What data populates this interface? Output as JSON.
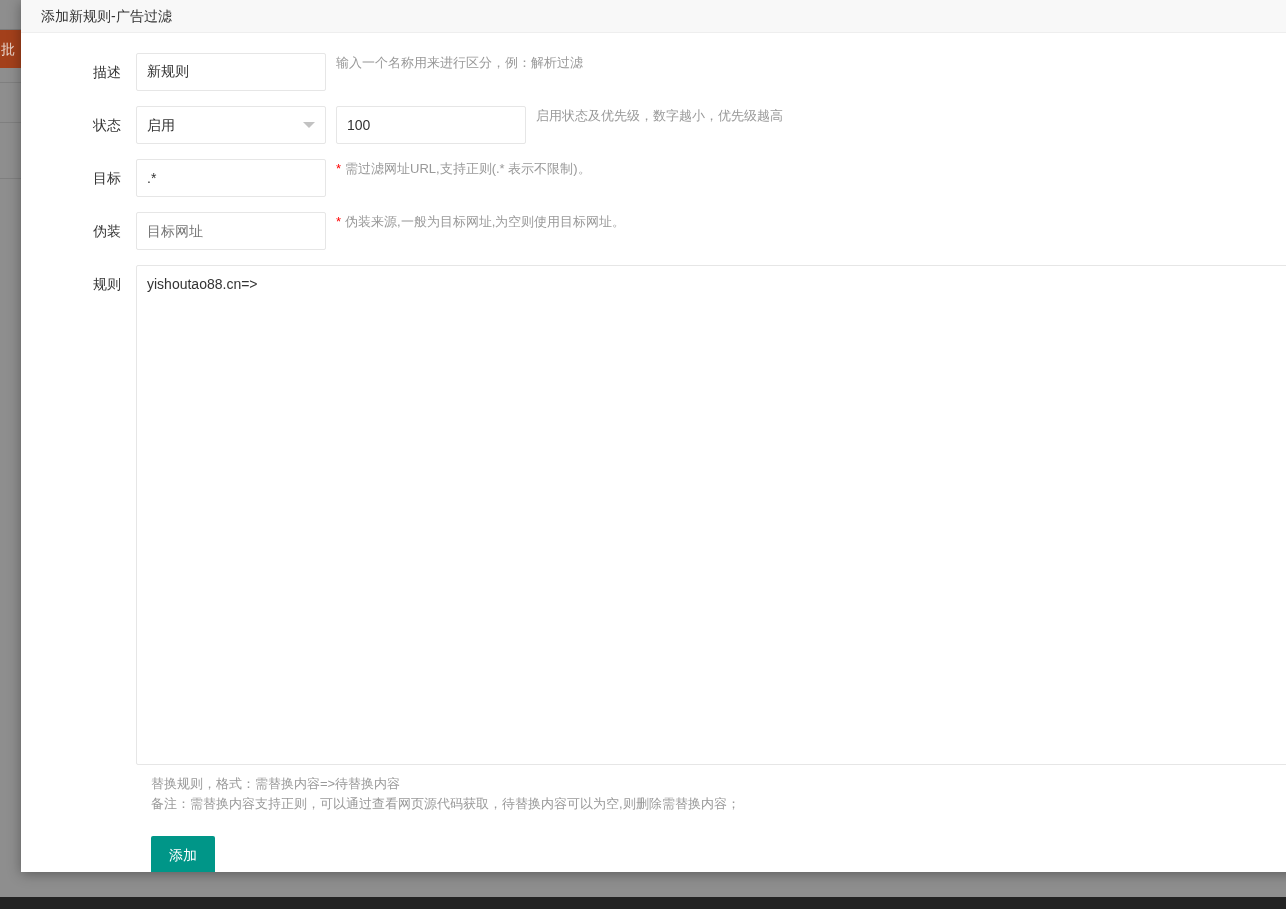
{
  "background": {
    "button": "批"
  },
  "dialog": {
    "title": "添加新规则-广告过滤",
    "fields": [
      {
        "kind": "text",
        "label": "描述",
        "value": "新规则",
        "hint": "输入一个名称用来进行区分，例：解析过滤"
      },
      {
        "kind": "select",
        "label": "状态",
        "value": "启用",
        "second_value": "100",
        "hint": "启用状态及优先级，数字越小，优先级越高"
      },
      {
        "kind": "text",
        "label": "目标",
        "value": ".*",
        "mark": "*",
        "hint": "需过滤网址URL,支持正则(.* 表示不限制)。"
      },
      {
        "kind": "text",
        "label": "伪装",
        "placeholder": "目标网址",
        "mark": "*",
        "hint": "伪装来源,一般为目标网址,为空则使用目标网址。"
      },
      {
        "kind": "textarea",
        "label": "规则",
        "value": "yishoutao88.cn=>",
        "notes": [
          "替换规则，格式：需替换内容=>待替换内容",
          "备注：需替换内容支持正则，可以通过查看网页源代码获取，待替换内容可以为空,则删除需替换内容；"
        ]
      }
    ],
    "submit": "添加"
  }
}
